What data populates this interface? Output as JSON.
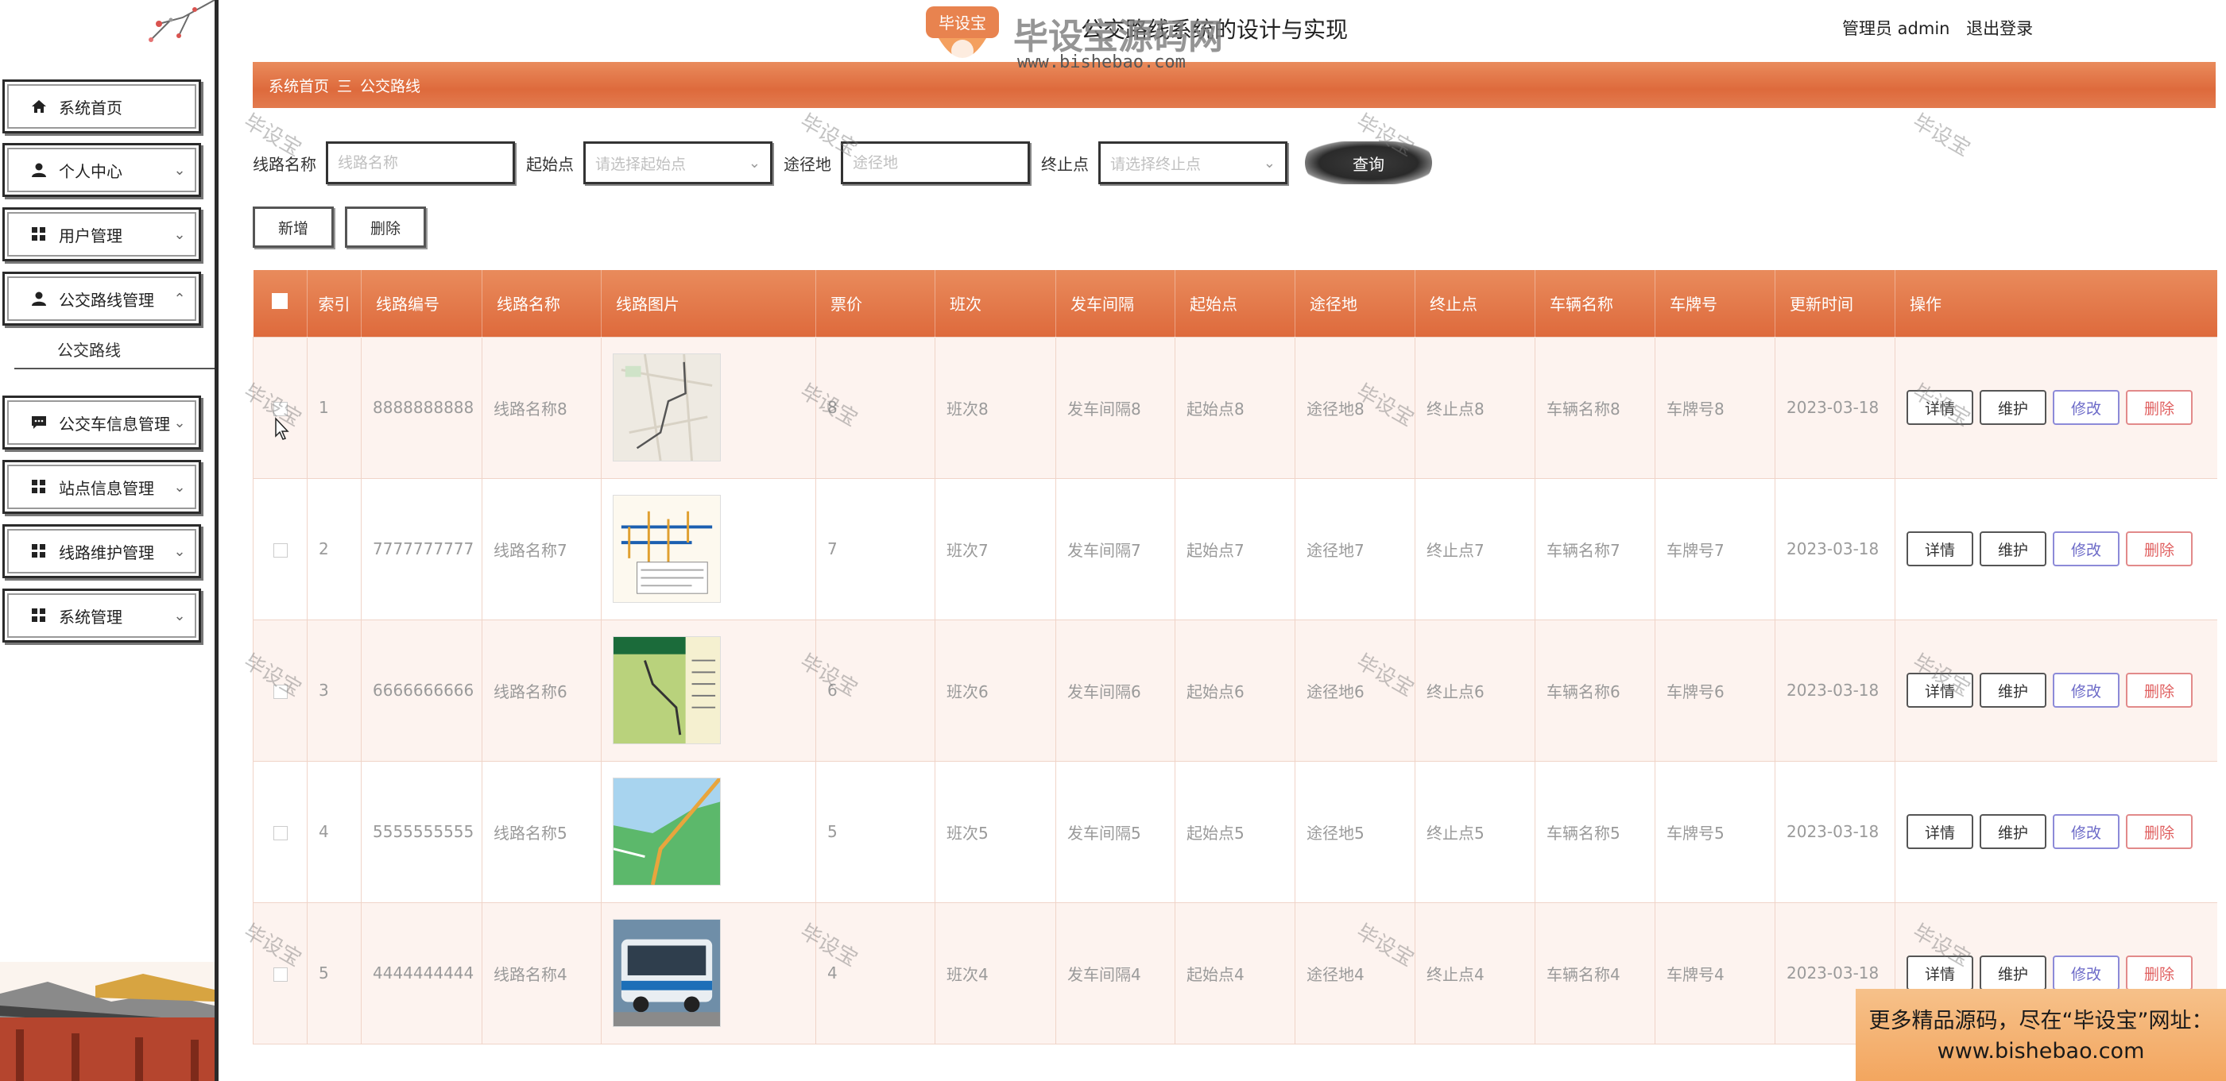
{
  "app": {
    "title": "公交路线系统的设计与实现",
    "user_label": "管理员 admin",
    "logout_label": "退出登录"
  },
  "sidebar": {
    "items": [
      {
        "label": "系统首页",
        "icon": "home-icon"
      },
      {
        "label": "个人中心",
        "icon": "person-icon"
      },
      {
        "label": "用户管理",
        "icon": "grid-icon"
      },
      {
        "label": "公交路线管理",
        "icon": "person-icon"
      },
      {
        "label": "公交车信息管理",
        "icon": "chat-icon"
      },
      {
        "label": "站点信息管理",
        "icon": "grid-icon"
      },
      {
        "label": "线路维护管理",
        "icon": "grid-icon"
      },
      {
        "label": "系统管理",
        "icon": "grid-icon"
      }
    ],
    "sub_item": "公交路线"
  },
  "breadcrumb": {
    "home": "系统首页",
    "separator": "三",
    "current": "公交路线"
  },
  "search": {
    "route_name_label": "线路名称",
    "route_name_placeholder": "线路名称",
    "start_label": "起始点",
    "start_placeholder": "请选择起始点",
    "via_label": "途径地",
    "via_placeholder": "途径地",
    "end_label": "终止点",
    "end_placeholder": "请选择终止点",
    "query_label": "查询"
  },
  "actions": {
    "add_label": "新增",
    "delete_label": "删除"
  },
  "table": {
    "headers": [
      "索引",
      "线路编号",
      "线路名称",
      "线路图片",
      "票价",
      "班次",
      "发车间隔",
      "起始点",
      "途径地",
      "终止点",
      "车辆名称",
      "车牌号",
      "更新时间",
      "操作"
    ],
    "rows": [
      {
        "index": "1",
        "code": "8888888888",
        "name": "线路名称8",
        "image": "map-thumbnail",
        "price": "8",
        "shift": "班次8",
        "interval": "发车间隔8",
        "start": "起始点8",
        "via": "途径地8",
        "end": "终止点8",
        "vehicle": "车辆名称8",
        "plate": "车牌号8",
        "updated": "2023-03-18"
      },
      {
        "index": "2",
        "code": "7777777777",
        "name": "线路名称7",
        "image": "route-diagram-thumbnail",
        "price": "7",
        "shift": "班次7",
        "interval": "发车间隔7",
        "start": "起始点7",
        "via": "途径地7",
        "end": "终止点7",
        "vehicle": "车辆名称7",
        "plate": "车牌号7",
        "updated": "2023-03-18"
      },
      {
        "index": "3",
        "code": "6666666666",
        "name": "线路名称6",
        "image": "line-map-thumbnail",
        "price": "6",
        "shift": "班次6",
        "interval": "发车间隔6",
        "start": "起始点6",
        "via": "途径地6",
        "end": "终止点6",
        "vehicle": "车辆名称6",
        "plate": "车牌号6",
        "updated": "2023-03-18"
      },
      {
        "index": "4",
        "code": "5555555555",
        "name": "线路名称5",
        "image": "coast-map-thumbnail",
        "price": "5",
        "shift": "班次5",
        "interval": "发车间隔5",
        "start": "起始点5",
        "via": "途径地5",
        "end": "终止点5",
        "vehicle": "车辆名称5",
        "plate": "车牌号5",
        "updated": "2023-03-18"
      },
      {
        "index": "5",
        "code": "4444444444",
        "name": "线路名称4",
        "image": "bus-photo-thumbnail",
        "price": "4",
        "shift": "班次4",
        "interval": "发车间隔4",
        "start": "起始点4",
        "via": "途径地4",
        "end": "终止点4",
        "vehicle": "车辆名称4",
        "plate": "车牌号4",
        "updated": "2023-03-18"
      }
    ],
    "row_buttons": {
      "detail": "详情",
      "maintain": "维护",
      "edit": "修改",
      "delete": "删除"
    }
  },
  "watermark": {
    "logo_text": "毕设宝源码网",
    "logo_badge": "毕设宝",
    "logo_url": "www.bishebao.com",
    "tile_text": "毕设宝"
  },
  "promo": {
    "line1": "更多精品源码，尽在“毕设宝”网址：",
    "line2": "www.bishebao.com"
  },
  "colors": {
    "accent": "#e27445",
    "row_odd": "#fdf3ef",
    "edit": "#6c6ac8",
    "delete": "#e06060"
  }
}
